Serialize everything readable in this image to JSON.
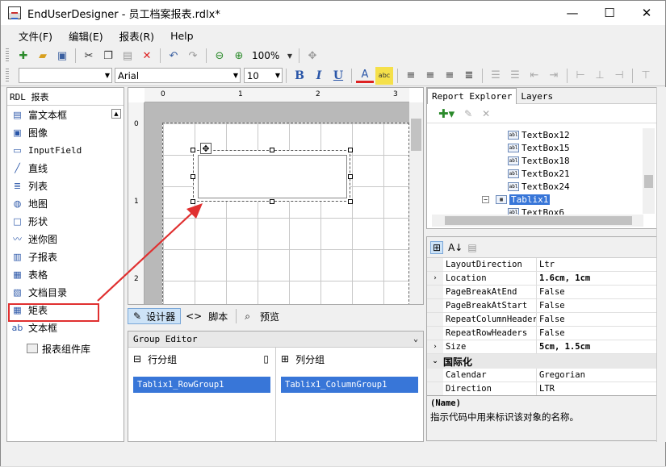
{
  "window": {
    "title": "EndUserDesigner - 员工档案报表.rdlx*",
    "minimize": "—",
    "maximize": "☐",
    "close": "✕"
  },
  "menu": [
    "文件(F)",
    "编辑(E)",
    "报表(R)",
    "Help"
  ],
  "toolbar": {
    "zoom": "100%",
    "font": "Arial",
    "size": "10"
  },
  "toolbox": {
    "header": "RDL 报表",
    "items": [
      {
        "label": "富文本框",
        "icon": "rich-text-icon"
      },
      {
        "label": "图像",
        "icon": "image-icon"
      },
      {
        "label": "InputField",
        "icon": "input-field-icon"
      },
      {
        "label": "直线",
        "icon": "line-icon"
      },
      {
        "label": "列表",
        "icon": "list-icon"
      },
      {
        "label": "地图",
        "icon": "map-icon"
      },
      {
        "label": "形状",
        "icon": "shape-icon"
      },
      {
        "label": "迷你图",
        "icon": "sparkline-icon"
      },
      {
        "label": "子报表",
        "icon": "subreport-icon"
      },
      {
        "label": "表格",
        "icon": "table-icon"
      },
      {
        "label": "文档目录",
        "icon": "toc-icon"
      },
      {
        "label": "矩表",
        "icon": "tablix-icon"
      },
      {
        "label": "文本框",
        "icon": "textbox-icon"
      }
    ],
    "library": "报表组件库"
  },
  "ruler": {
    "h": [
      "0",
      "1",
      "2",
      "3"
    ],
    "v": [
      "0",
      "1",
      "2"
    ]
  },
  "modes": {
    "designer": "设计器",
    "script": "脚本",
    "preview": "预览"
  },
  "group_editor": {
    "title": "Group Editor",
    "row_title": "行分组",
    "col_title": "列分组",
    "row_item": "Tablix1_RowGroup1",
    "col_item": "Tablix1_ColumnGroup1"
  },
  "explorer": {
    "tabs": [
      "Report Explorer",
      "Layers"
    ],
    "nodes": [
      "TextBox12",
      "TextBox15",
      "TextBox18",
      "TextBox21",
      "TextBox24",
      "Tablix1",
      "TextBox6"
    ],
    "selected": "Tablix1"
  },
  "properties": {
    "rows": [
      {
        "name": "LayoutDirection",
        "value": "Ltr",
        "bold": false,
        "exp": ""
      },
      {
        "name": "Location",
        "value": "1.6cm, 1cm",
        "bold": true,
        "exp": "›"
      },
      {
        "name": "PageBreakAtEnd",
        "value": "False",
        "bold": false,
        "exp": ""
      },
      {
        "name": "PageBreakAtStart",
        "value": "False",
        "bold": false,
        "exp": ""
      },
      {
        "name": "RepeatColumnHeaders",
        "value": "False",
        "bold": false,
        "exp": ""
      },
      {
        "name": "RepeatRowHeaders",
        "value": "False",
        "bold": false,
        "exp": ""
      },
      {
        "name": "Size",
        "value": "5cm, 1.5cm",
        "bold": true,
        "exp": "›"
      }
    ],
    "category": "国际化",
    "rows2": [
      {
        "name": "Calendar",
        "value": "Gregorian"
      },
      {
        "name": "Direction",
        "value": "LTR"
      }
    ],
    "desc_name": "(Name)",
    "desc_text": "指示代码中用来标识该对象的名称。"
  }
}
